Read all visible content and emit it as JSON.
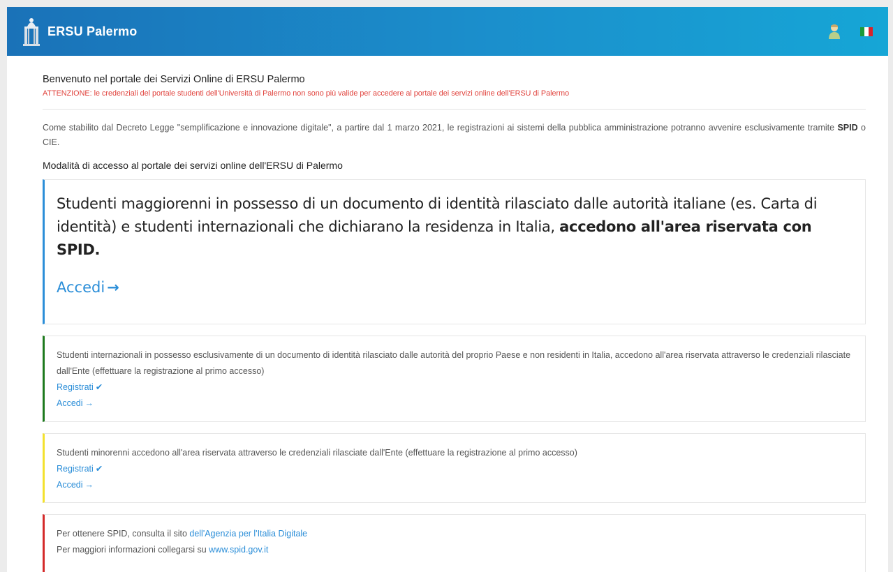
{
  "navbar": {
    "brand": "ERSU Palermo",
    "brand_icon": "ersu-logo-icon",
    "user_icon": "user-icon",
    "language_icon": "italian-flag-icon",
    "colors": {
      "gradient_start": "#1a72b8",
      "gradient_end": "#16a6d6"
    }
  },
  "header": {
    "welcome": "Benvenuto nel portale dei Servizi Online di ERSU Palermo",
    "warning": "ATTENZIONE: le credenziali del portale studenti dell'Università di Palermo non sono più valide per accedere al portale dei servizi online dell'ERSU di Palermo"
  },
  "decree": {
    "text_before": "Come stabilito dal Decreto Legge \"semplificazione e innovazione digitale\", a partire dal 1 marzo 2021, le registrazioni ai sistemi della pubblica amministrazione potranno avvenire esclusivamente tramite ",
    "spid": "SPID",
    "text_after": " o CIE."
  },
  "access_title": "Modalità di accesso al portale dei servizi online dell'ERSU di Palermo",
  "cards": {
    "spid": {
      "text": "Studenti maggiorenni in possesso di un documento di identità rilasciato dalle autorità italiane (es. Carta di identità) e studenti internazionali che dichiarano la residenza in Italia, ",
      "bold": "accedono all'area riservata con SPID.",
      "link": "Accedi",
      "border_color": "#2b8ed8"
    },
    "international": {
      "text": "Studenti internazionali in possesso esclusivamente di un documento di identità rilasciato dalle autorità del proprio Paese e non residenti in Italia, accedono all'area riservata attraverso le credenziali rilasciate dall'Ente (effettuare la registrazione al primo accesso)",
      "register": "Registrati",
      "login": "Accedi",
      "border_color": "#1e7a1e"
    },
    "minor": {
      "text": "Studenti minorenni accedono all'area riservata attraverso le credenziali rilasciate dall'Ente (effettuare la registrazione al primo accesso)",
      "register": "Registrati",
      "login": "Accedi",
      "border_color": "#f3e12e"
    },
    "info": {
      "line1_text": "Per ottenere SPID, consulta il sito ",
      "line1_link": "dell'Agenzia per l'Italia Digitale",
      "line2_text": "Per maggiori informazioni collegarsi su ",
      "line2_link": "www.spid.gov.it",
      "border_color": "#d42a2a"
    }
  }
}
